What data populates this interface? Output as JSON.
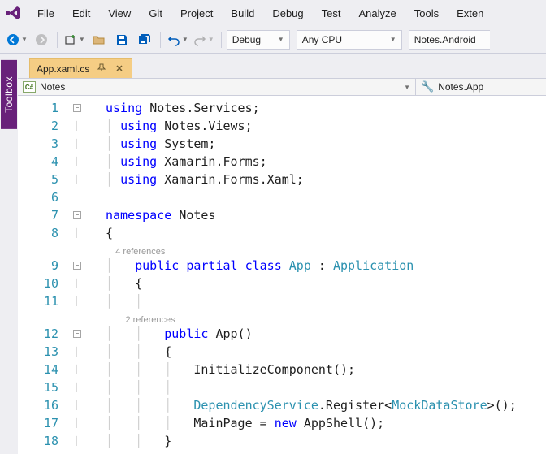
{
  "menu": {
    "items": [
      "File",
      "Edit",
      "View",
      "Git",
      "Project",
      "Build",
      "Debug",
      "Test",
      "Analyze",
      "Tools",
      "Exten"
    ]
  },
  "toolbar": {
    "config": "Debug",
    "platform": "Any CPU",
    "target": "Notes.Android"
  },
  "sidebar": {
    "toolbox": "Toolbox"
  },
  "tab": {
    "filename": "App.xaml.cs"
  },
  "nav": {
    "project_label": "Notes",
    "scope_label": "Notes.App"
  },
  "codelens": {
    "class_refs": "4 references",
    "ctor_refs": "2 references"
  },
  "code": {
    "l1": {
      "a": "using ",
      "b": "Notes.Services;"
    },
    "l2": {
      "a": "using ",
      "b": "Notes.Views;"
    },
    "l3": {
      "a": "using ",
      "b": "System;"
    },
    "l4": {
      "a": "using ",
      "b": "Xamarin.Forms;"
    },
    "l5": {
      "a": "using ",
      "b": "Xamarin.Forms.Xaml;"
    },
    "l7": {
      "a": "namespace ",
      "b": "Notes"
    },
    "l8": "{",
    "l9": {
      "a": "public ",
      "b": "partial ",
      "c": "class ",
      "d": "App ",
      "e": ": ",
      "f": "Application"
    },
    "l10": "{",
    "l12": {
      "a": "public ",
      "b": "App()"
    },
    "l13": "{",
    "l14": "InitializeComponent();",
    "l16": {
      "a": "DependencyService",
      "b": ".Register<",
      "c": "MockDataStore",
      "d": ">();"
    },
    "l17": {
      "a": "MainPage = ",
      "b": "new ",
      "c": "AppShell();"
    },
    "l18": "}"
  },
  "line_numbers": [
    "1",
    "2",
    "3",
    "4",
    "5",
    "6",
    "7",
    "8",
    "9",
    "10",
    "11",
    "12",
    "13",
    "14",
    "15",
    "16",
    "17",
    "18"
  ]
}
